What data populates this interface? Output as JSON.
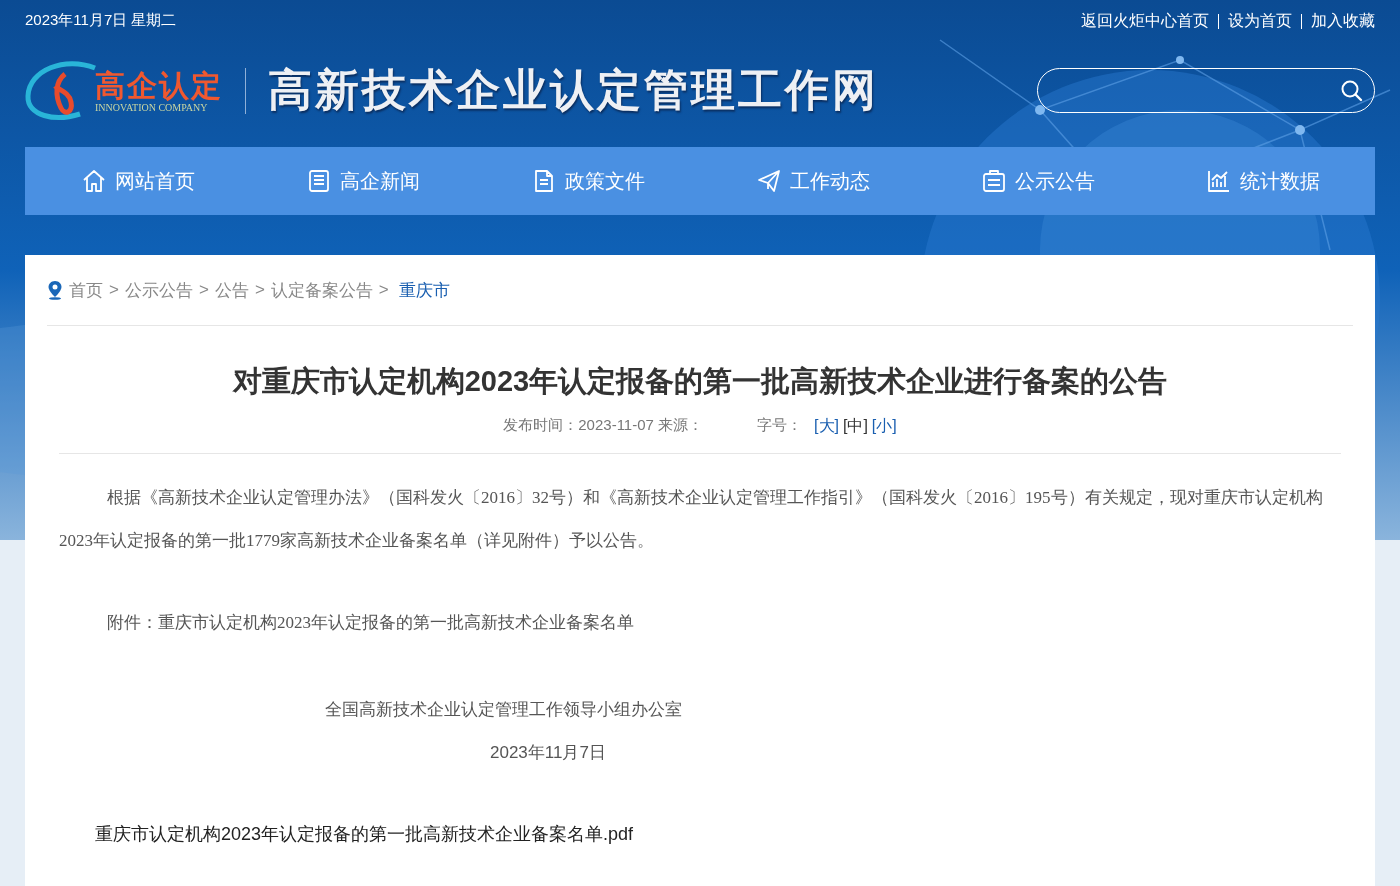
{
  "top_bar": {
    "date": "2023年11月7日 星期二",
    "links": [
      "返回火炬中心首页",
      "设为首页",
      "加入收藏"
    ]
  },
  "logo": {
    "name": "高企认定",
    "subtitle": "INNOVATION COMPANY"
  },
  "site_title": "高新技术企业认定管理工作网",
  "nav": [
    {
      "label": "网站首页",
      "kind": "home"
    },
    {
      "label": "高企新闻",
      "kind": "news"
    },
    {
      "label": "政策文件",
      "kind": "file"
    },
    {
      "label": "工作动态",
      "kind": "plane"
    },
    {
      "label": "公示公告",
      "kind": "board"
    },
    {
      "label": "统计数据",
      "kind": "chart"
    }
  ],
  "breadcrumb": [
    {
      "label": "首页",
      "current": false
    },
    {
      "separator": ">",
      "label": "公示公告",
      "current": false
    },
    {
      "separator": ">",
      "label": "公告",
      "current": false
    },
    {
      "separator": ">",
      "label": "认定备案公告",
      "current": false
    },
    {
      "separator": ">",
      "label": "重庆市",
      "current": true
    }
  ],
  "article": {
    "title": "对重庆市认定机构2023年认定报备的第一批高新技术企业进行备案的公告",
    "meta": "发布时间：2023-11-07 来源：",
    "font_size_label": "字号：",
    "font_sizes": [
      {
        "label": "[大]",
        "selected": false
      },
      {
        "label": "[中]",
        "selected": true
      },
      {
        "label": "[小]",
        "selected": false
      }
    ],
    "body": "根据《高新技术企业认定管理办法》（国科发火〔2016〕32号）和《高新技术企业认定管理工作指引》（国科发火〔2016〕195号）有关规定，现对重庆市认定机构2023年认定报备的第一批1779家高新技术企业备案名单（详见附件）予以公告。",
    "attachment_note": "附件：重庆市认定机构2023年认定报备的第一批高新技术企业备案名单",
    "signature": "全国高新技术企业认定管理工作领导小组办公室",
    "date": "2023年11月7日",
    "attachment_link": "重庆市认定机构2023年认定报备的第一批高新技术企业备案名单.pdf"
  }
}
